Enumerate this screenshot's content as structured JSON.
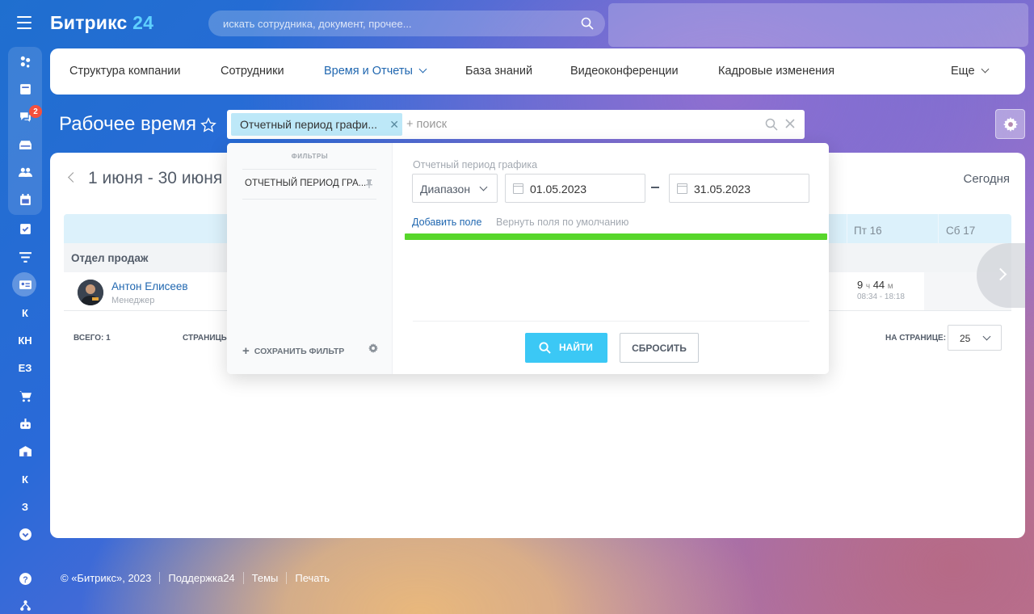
{
  "app": {
    "logo_text": "Битрикс",
    "logo_number": "24",
    "search_placeholder": "искать сотрудника, документ, прочее..."
  },
  "rail": {
    "chat_badge": "2",
    "letters": [
      "К",
      "КН",
      "ЕЗ",
      "К",
      "З"
    ]
  },
  "nav": {
    "items": [
      "Структура компании",
      "Сотрудники",
      "Время и Отчеты",
      "База знаний",
      "Видеоконференции",
      "Кадровые изменения"
    ],
    "more": "Еще"
  },
  "page": {
    "title": "Рабочее время",
    "filter_tag": "Отчетный период графи...",
    "filter_search_placeholder": "+ поиск"
  },
  "panel": {
    "period": "1 июня - 30 июня",
    "today": "Сегодня",
    "days": [
      "Пт 16",
      "Сб 17"
    ],
    "department": "Отдел продаж",
    "employee": {
      "name": "Антон Елисеев",
      "position": "Менеджер",
      "hours": "9",
      "hours_unit": "ч",
      "minutes": "44",
      "minutes_unit": "м",
      "range": "08:34 - 18:18"
    },
    "total_label": "ВСЕГО: 1",
    "pages_label": "СТРАНИЦЫ",
    "per_page_label": "НА СТРАНИЦЕ:",
    "per_page_value": "25"
  },
  "popup": {
    "filters_header": "ФИЛЬТРЫ",
    "preset": "ОТЧЕТНЫЙ ПЕРИОД ГРА...",
    "save_filter": "СОХРАНИТЬ ФИЛЬТР",
    "field_label": "Отчетный период графика",
    "range_select": "Диапазон",
    "date_from": "01.05.2023",
    "date_to": "31.05.2023",
    "add_field": "Добавить поле",
    "restore_fields": "Вернуть поля по умолчанию",
    "find_button": "НАЙТИ",
    "reset_button": "СБРОСИТЬ"
  },
  "footer": {
    "copyright": "© «Битрикс», 2023",
    "support": "Поддержка24",
    "themes": "Темы",
    "print": "Печать"
  },
  "colors": {
    "accent": "#2067b0",
    "find_button": "#3bc8f5",
    "highlight": "#57d62b",
    "badge": "#f5503c"
  }
}
